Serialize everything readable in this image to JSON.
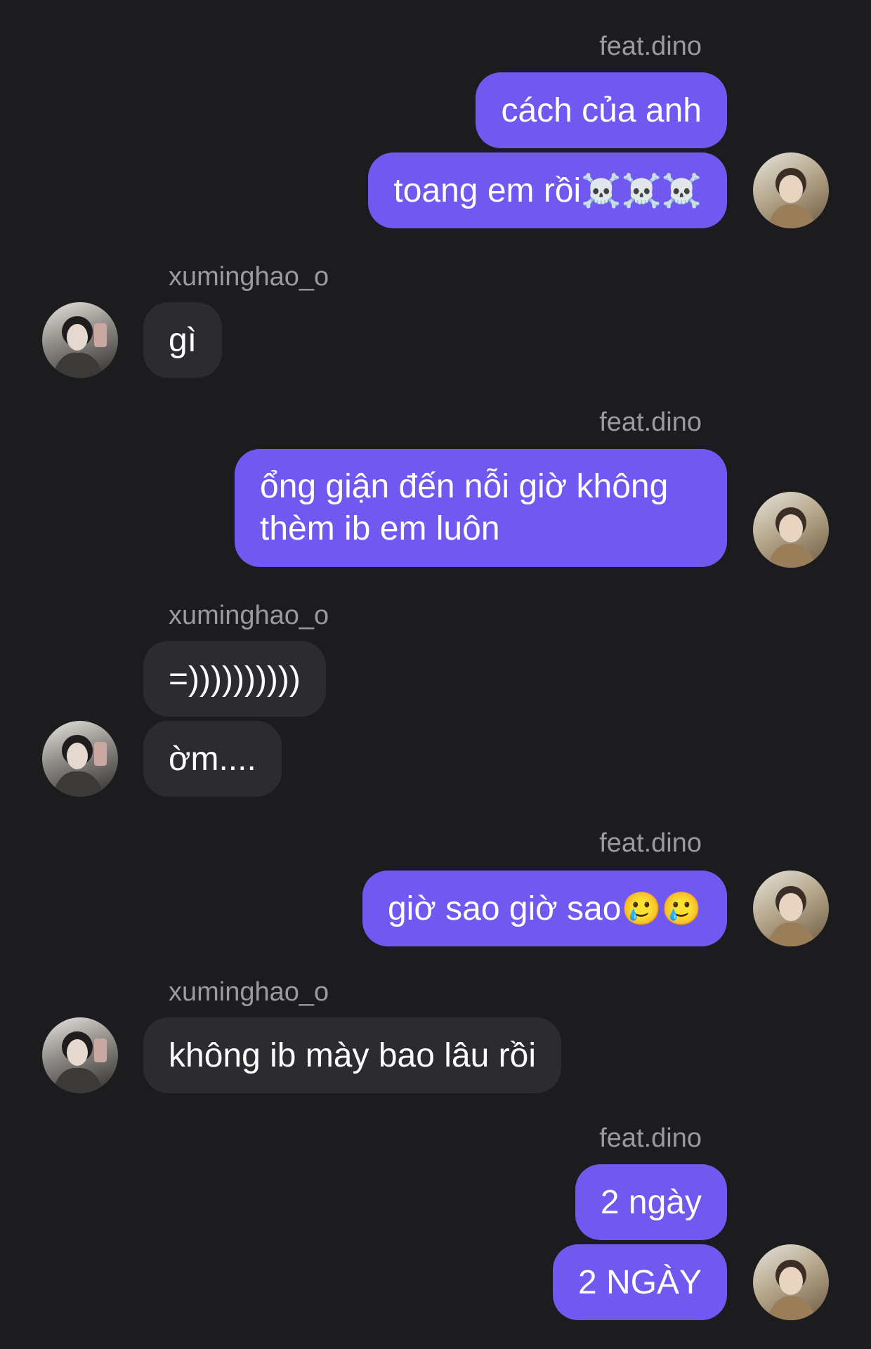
{
  "names": {
    "me": "feat.dino",
    "other": "xuminghao_o"
  },
  "messages": [
    {
      "id": "m1",
      "text": "cách của anh"
    },
    {
      "id": "m2",
      "text": "toang em rồi",
      "emoji": "☠️☠️☠️"
    },
    {
      "id": "m3",
      "text": "gì"
    },
    {
      "id": "m4",
      "text": "ổng giận đến nỗi giờ không thèm ib em luôn"
    },
    {
      "id": "m5",
      "text": "=))))))))))"
    },
    {
      "id": "m6",
      "text": "ờm...."
    },
    {
      "id": "m7",
      "text": "giờ sao giờ sao",
      "emoji": "🥲🥲"
    },
    {
      "id": "m8",
      "text": "không ib mày bao lâu rồi"
    },
    {
      "id": "m9",
      "text": "2 ngày"
    },
    {
      "id": "m10",
      "text": "2 NGÀY"
    }
  ],
  "colors": {
    "background": "#1c1c1f",
    "outgoing_bubble": "#7058f0",
    "incoming_bubble": "#2c2c30",
    "username": "#9a9aa0"
  }
}
